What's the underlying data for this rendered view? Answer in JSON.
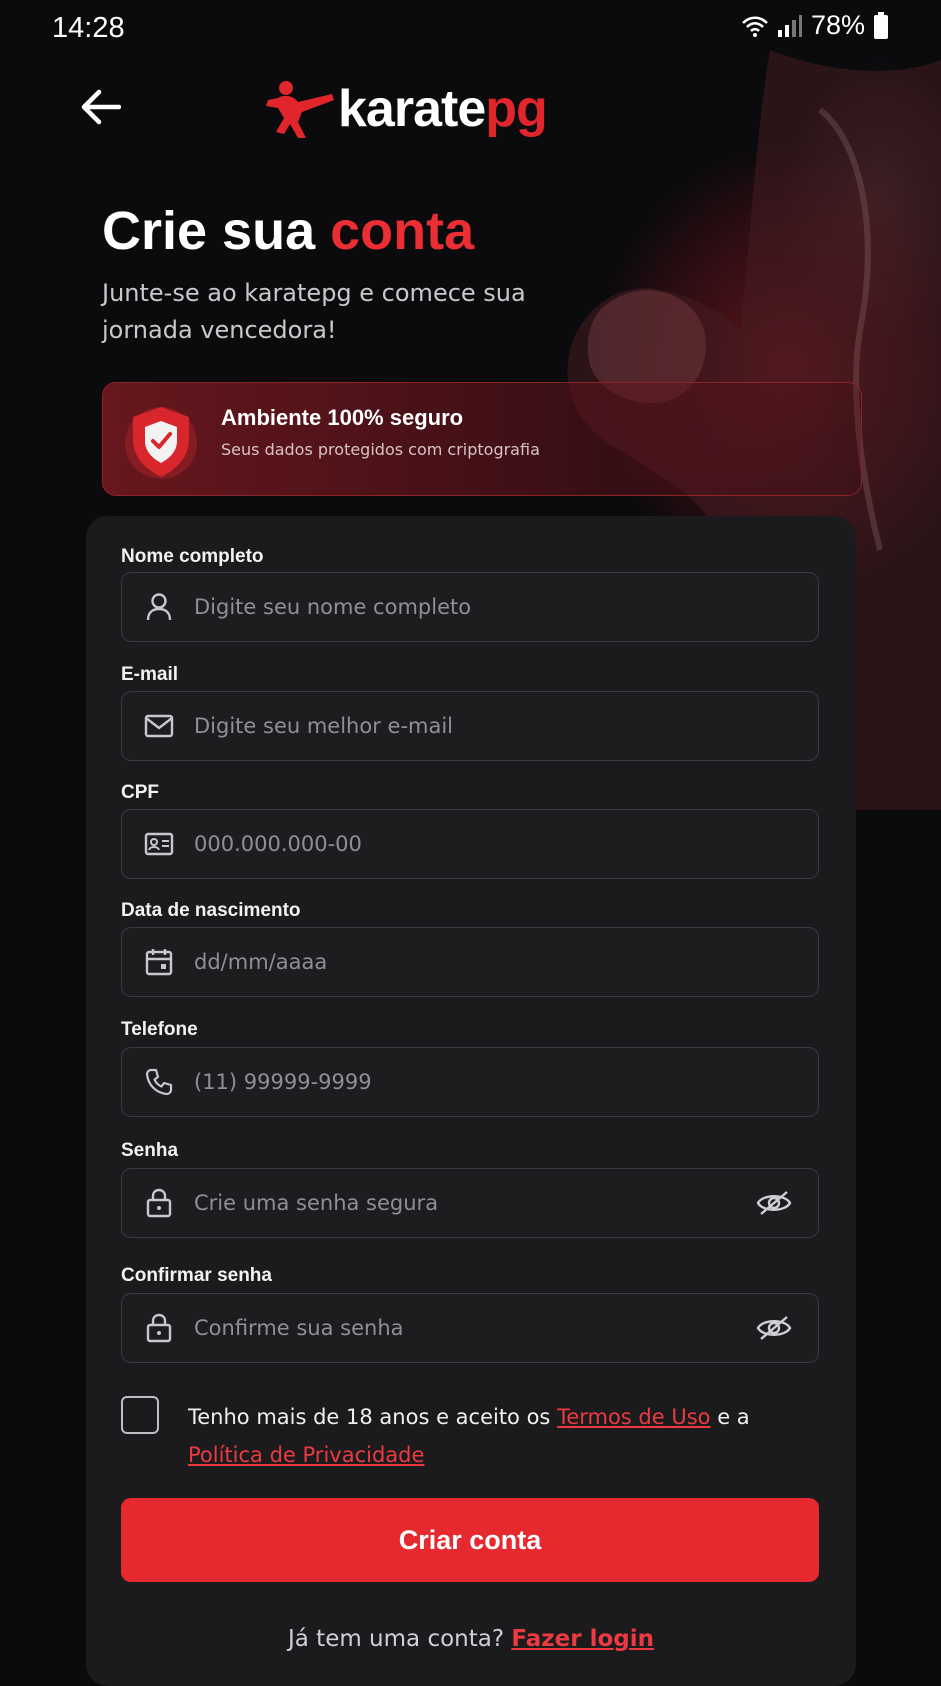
{
  "status_bar": {
    "time": "14:28",
    "battery": "78%"
  },
  "header": {
    "logo_main": "karate",
    "logo_accent": "pg"
  },
  "hero": {
    "title_main": "Crie sua ",
    "title_accent": "conta",
    "subtitle": "Junte-se ao karatepg e comece sua jornada vencedora!"
  },
  "secure_banner": {
    "title": "Ambiente 100% seguro",
    "description": "Seus dados protegidos com criptografia"
  },
  "form": {
    "full_name": {
      "label": "Nome completo",
      "placeholder": "Digite seu nome completo"
    },
    "email": {
      "label": "E-mail",
      "placeholder": "Digite seu melhor e-mail"
    },
    "cpf": {
      "label": "CPF",
      "placeholder": "000.000.000-00"
    },
    "birth_date": {
      "label": "Data de nascimento",
      "placeholder": "dd/mm/aaaa"
    },
    "phone": {
      "label": "Telefone",
      "placeholder": "(11) 99999-9999"
    },
    "password": {
      "label": "Senha",
      "placeholder": "Crie uma senha segura"
    },
    "confirm_password": {
      "label": "Confirmar senha",
      "placeholder": "Confirme sua senha"
    },
    "terms": {
      "prefix": "Tenho mais de 18 anos e aceito os ",
      "terms_link": "Termos de Uso",
      "middle": " e a ",
      "privacy_link": "Política de Privacidade"
    },
    "submit_label": "Criar conta",
    "login_prompt": "Já tem uma conta? ",
    "login_link": "Fazer login"
  },
  "colors": {
    "accent": "#e6292f",
    "background": "#0b0a0d",
    "card": "#1b1b1e"
  }
}
